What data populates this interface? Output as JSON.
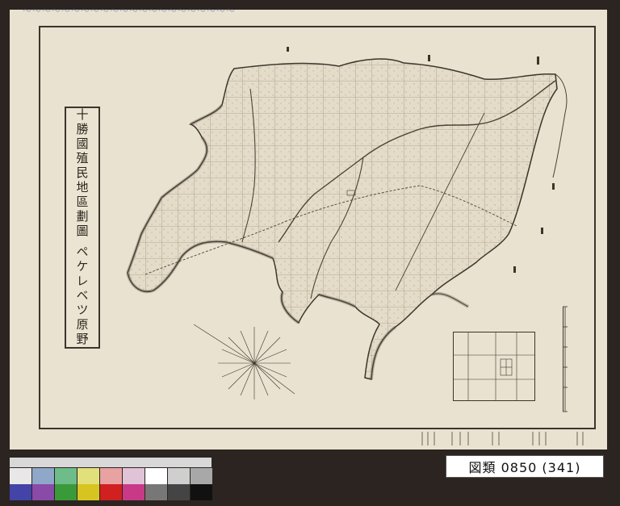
{
  "map": {
    "title": "十勝國殖民地區劃圖 ペケレベツ原野",
    "catalog_label": "図類 0850 (341)"
  },
  "colors": {
    "paper": "#e9e2d0",
    "ink": "#3b352c",
    "background": "#2b2420"
  },
  "icons": [
    "compass-rose-icon",
    "legend-icon",
    "scale-bar-icon",
    "color-checker-icon"
  ]
}
